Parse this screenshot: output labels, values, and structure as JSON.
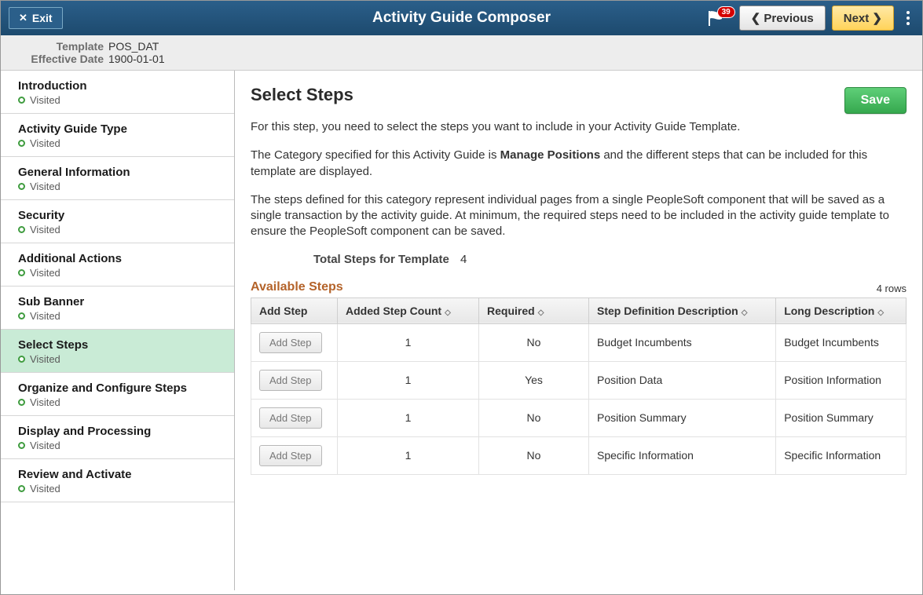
{
  "banner": {
    "exit_label": "Exit",
    "title": "Activity Guide Composer",
    "notification_count": "39",
    "previous_label": "Previous",
    "next_label": "Next"
  },
  "subheader": {
    "template_label": "Template",
    "template_value": "POS_DAT",
    "effdt_label": "Effective Date",
    "effdt_value": "1900-01-01"
  },
  "sidebar": {
    "items": [
      {
        "title": "Introduction",
        "status": "Visited"
      },
      {
        "title": "Activity Guide Type",
        "status": "Visited"
      },
      {
        "title": "General Information",
        "status": "Visited"
      },
      {
        "title": "Security",
        "status": "Visited"
      },
      {
        "title": "Additional Actions",
        "status": "Visited"
      },
      {
        "title": "Sub Banner",
        "status": "Visited"
      },
      {
        "title": "Select Steps",
        "status": "Visited",
        "selected": true
      },
      {
        "title": "Organize and Configure Steps",
        "status": "Visited"
      },
      {
        "title": "Display and Processing",
        "status": "Visited"
      },
      {
        "title": "Review and Activate",
        "status": "Visited"
      }
    ]
  },
  "main": {
    "page_title": "Select Steps",
    "save_label": "Save",
    "intro_line1": "For this step, you need to select the steps you want to include in your Activity Guide Template.",
    "intro_line2a": "The Category specified for this Activity Guide is ",
    "intro_line2b": "Manage Positions",
    "intro_line2c": " and the different steps that can be included for this template are displayed.",
    "intro_line3": "The steps defined for this category represent individual pages from a single PeopleSoft component that will be saved as a single transaction by the activity guide. At minimum, the required steps need to be included in the activity guide template to ensure the PeopleSoft component can be saved.",
    "total_label": "Total Steps for Template",
    "total_value": "4",
    "available_title": "Available Steps",
    "rowcount": "4 rows",
    "columns": {
      "addstep": "Add Step",
      "count": "Added Step Count",
      "required": "Required",
      "stepdef": "Step Definition Description",
      "longdesc": "Long Description"
    },
    "add_step_btn": "Add Step",
    "rows": [
      {
        "count": "1",
        "required": "No",
        "stepdef": "Budget Incumbents",
        "longdesc": "Budget Incumbents"
      },
      {
        "count": "1",
        "required": "Yes",
        "stepdef": "Position Data",
        "longdesc": "Position Information"
      },
      {
        "count": "1",
        "required": "No",
        "stepdef": "Position Summary",
        "longdesc": "Position Summary"
      },
      {
        "count": "1",
        "required": "No",
        "stepdef": "Specific Information",
        "longdesc": "Specific Information"
      }
    ]
  }
}
